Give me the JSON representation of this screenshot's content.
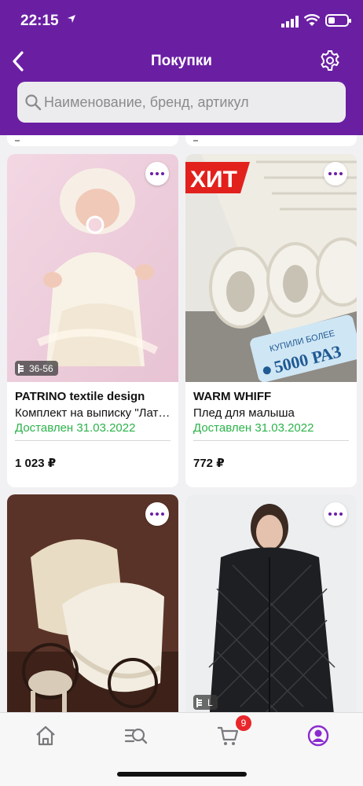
{
  "status_bar": {
    "time": "22:15"
  },
  "header": {
    "title": "Покупки",
    "back_icon": "chevron-left-icon",
    "settings_icon": "gear-icon"
  },
  "search": {
    "placeholder": "Наименование, бренд, артикул",
    "value": ""
  },
  "products": [
    {
      "brand": "PATRINO textile design",
      "name": "Комплект на выписку \"Латте\"",
      "status": "Доставлен 31.03.2022",
      "price": "1 023 ₽",
      "size_badge": "36-56"
    },
    {
      "brand": "WARM WHIFF",
      "name": "Плед для малыша",
      "status": "Доставлен 31.03.2022",
      "price": "772 ₽",
      "image_text": {
        "hit": "ХИТ",
        "tag_line1": "КУПИЛИ БОЛЕЕ",
        "tag_line2": "5000 РАЗ"
      }
    },
    {
      "brand": "",
      "name": "",
      "status": "",
      "price": ""
    },
    {
      "brand": "",
      "name": "",
      "status": "",
      "price": "",
      "size_badge": "L"
    }
  ],
  "tab_bar": {
    "items": [
      "home-icon",
      "catalog-search-icon",
      "cart-icon",
      "profile-icon"
    ],
    "cart_count": "9",
    "active_color": "#8a2bcf"
  },
  "colors": {
    "brand": "#6a1fa3",
    "delivered": "#2bb34a"
  }
}
